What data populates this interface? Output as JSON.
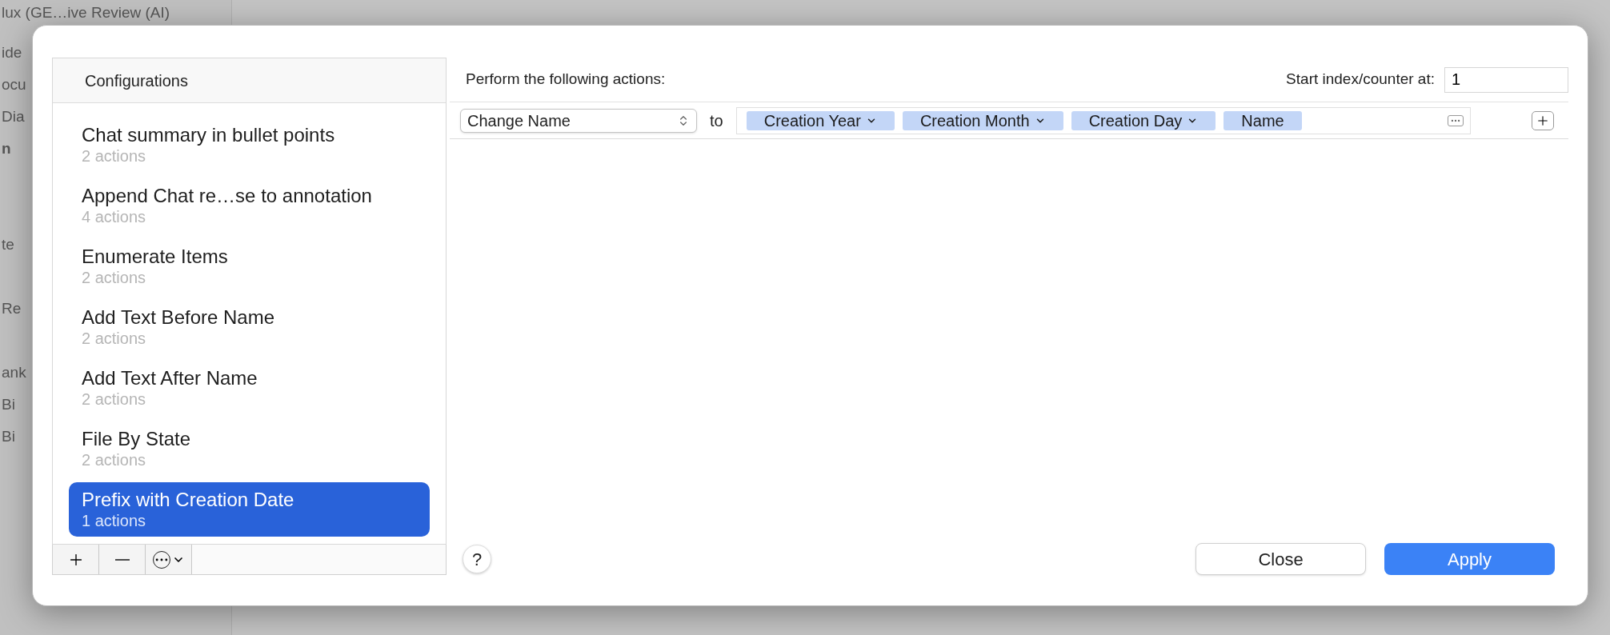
{
  "background": {
    "fragments": [
      {
        "text": "lux (GE…ive Review (AI)",
        "bold": false
      },
      {
        "text": "ide",
        "bold": false
      },
      {
        "text": "ocu",
        "bold": false
      },
      {
        "text": "Dia",
        "bold": false
      },
      {
        "text": "n",
        "bold": true
      },
      {
        "text": "te",
        "bold": false
      },
      {
        "text": "Re",
        "bold": false
      },
      {
        "text": "ank",
        "bold": false
      },
      {
        "text": "Bi",
        "bold": false
      },
      {
        "text": "Bi",
        "bold": false
      }
    ]
  },
  "dialog": {
    "configurations": {
      "header": "Configurations",
      "items": [
        {
          "title": "Chat summary in bullet points",
          "subtitle": "2 actions",
          "selected": false
        },
        {
          "title": "Append Chat re…se to annotation",
          "subtitle": "4 actions",
          "selected": false
        },
        {
          "title": "Enumerate Items",
          "subtitle": "2 actions",
          "selected": false
        },
        {
          "title": "Add Text Before Name",
          "subtitle": "2 actions",
          "selected": false
        },
        {
          "title": "Add Text After Name",
          "subtitle": "2 actions",
          "selected": false
        },
        {
          "title": "File By State",
          "subtitle": "2 actions",
          "selected": false
        },
        {
          "title": "Prefix with Creation Date",
          "subtitle": "1 actions",
          "selected": true
        }
      ]
    },
    "actions_header": "Perform the following actions:",
    "start_index": {
      "label": "Start index/counter at:",
      "value": "1"
    },
    "action_rows": [
      {
        "action": "Change Name",
        "connector": "to",
        "tokens": [
          {
            "label": "Creation Year",
            "has_menu": true
          },
          {
            "label": "Creation Month",
            "has_menu": true
          },
          {
            "label": "Creation Day",
            "has_menu": true
          },
          {
            "label": "Name",
            "has_menu": false
          }
        ]
      }
    ],
    "help": "?",
    "buttons": [
      {
        "label": "Close",
        "kind": "secondary"
      },
      {
        "label": "Apply",
        "kind": "primary"
      }
    ]
  }
}
